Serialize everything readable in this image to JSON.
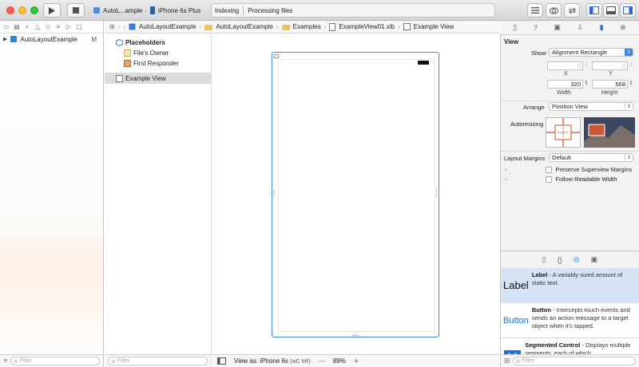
{
  "toolbar": {
    "scheme": "AutoL...ample",
    "device": "iPhone 6s Plus",
    "status_primary": "Indexing",
    "status_secondary": "Processing files"
  },
  "navigator": {
    "project_name": "AutoLayoutExample",
    "project_badge": "M",
    "filter_placeholder": "Filter"
  },
  "jumpbar": {
    "items": [
      "AutoLayoutExample",
      "AutoLayoutExample",
      "Examples",
      "ExampleView01.xib",
      "Example View"
    ]
  },
  "outline": {
    "group_label": "Placeholders",
    "items": [
      "File's Owner",
      "First Responder"
    ],
    "selected_view": "Example View",
    "filter_placeholder": "Filter"
  },
  "canvas": {
    "view_as_label": "View as: iPhone 6s",
    "size_class": "(wC hR)",
    "zoom_minus": "—",
    "zoom_level": "89%",
    "zoom_plus": "+"
  },
  "inspector": {
    "section_title": "View",
    "show_label": "Show",
    "show_value": "Alignment Rectangle",
    "x_value": "0",
    "y_value": "0",
    "x_label": "X",
    "y_label": "Y",
    "width_value": "320",
    "height_value": "568",
    "width_label": "Width",
    "height_label": "Height",
    "arrange_label": "Arrange",
    "arrange_value": "Position View",
    "autoresizing_label": "Autoresizing",
    "layout_margins_label": "Layout Margins",
    "layout_margins_value": "Default",
    "preserve_label": "Preserve Superview Margins",
    "readable_label": "Follow Readable Width"
  },
  "library": {
    "items": [
      {
        "icon_text": "Label",
        "title": "Label",
        "desc": "- A variably sized amount of static text."
      },
      {
        "icon_text": "Button",
        "title": "Button",
        "desc": "- Intercepts touch events and sends an action message to a target object when it's tapped."
      },
      {
        "icon_text": "1 2",
        "title": "Segmented Control",
        "desc": "- Displays multiple segments, each of which"
      }
    ],
    "filter_placeholder": "Filter"
  },
  "colors": {
    "accent": "#3b87f1",
    "selection": "#dcdcdc",
    "device_border": "#3c8fd6"
  }
}
